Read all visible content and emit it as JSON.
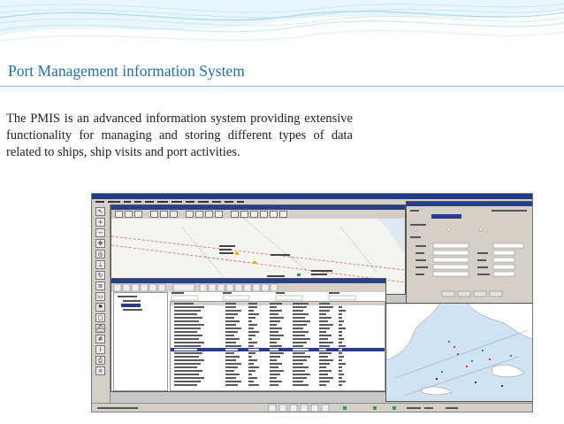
{
  "slide": {
    "title": "Port Management information System",
    "description": "The PMIS is an advanced information system providing extensive functionality for managing and storing different types of data related to ships, ship visits and port activities."
  },
  "colors": {
    "title": "#1f6fa8",
    "accent_line": "#7fc3dd",
    "app_titlebar": "#203a8c",
    "sea": "#cfe3f2",
    "land": "#ffffff"
  },
  "screenshot": {
    "toolbar_icons": [
      "pointer-icon",
      "zoom-in-icon",
      "zoom-out-icon",
      "pan-icon",
      "target-icon",
      "measure-icon",
      "refresh-icon",
      "layers-icon",
      "ruler-icon",
      "flag-icon",
      "select-icon",
      "vessel-icon",
      "grid-icon",
      "info-icon",
      "print-icon",
      "close-icon"
    ],
    "vessel_rows": 23,
    "selected_row": 12
  }
}
